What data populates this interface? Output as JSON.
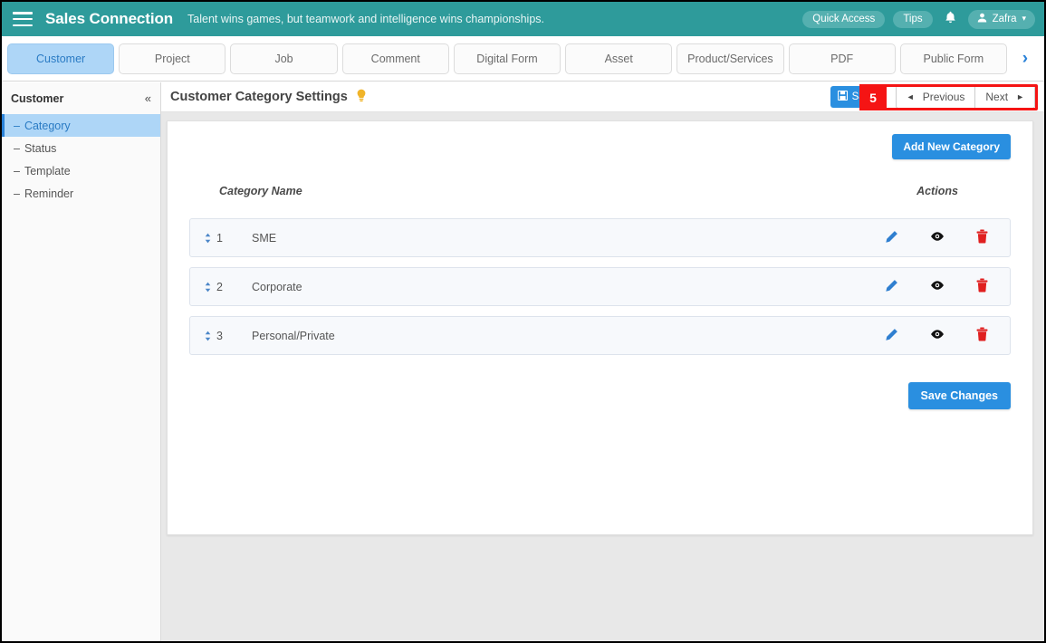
{
  "topbar": {
    "menu_icon": "hamburger-icon",
    "brand": "Sales Connection",
    "tagline": "Talent wins games, but teamwork and intelligence wins championships.",
    "quick_access": "Quick Access",
    "tips": "Tips",
    "bell_icon": "ὑ4",
    "user_name": "Zafra",
    "user_caret": "▾",
    "accent_color": "#2e9b9b"
  },
  "tabs": [
    {
      "label": "Customer",
      "active": true
    },
    {
      "label": "Project",
      "active": false
    },
    {
      "label": "Job",
      "active": false
    },
    {
      "label": "Comment",
      "active": false
    },
    {
      "label": "Digital Form",
      "active": false
    },
    {
      "label": "Asset",
      "active": false
    },
    {
      "label": "Product/Services",
      "active": false
    },
    {
      "label": "PDF",
      "active": false
    },
    {
      "label": "Public Form",
      "active": false
    }
  ],
  "tab_next_icon": "›",
  "sidebar": {
    "title": "Customer",
    "collapse_icon": "«",
    "items": [
      {
        "label": "Category",
        "active": true
      },
      {
        "label": "Status",
        "active": false
      },
      {
        "label": "Template",
        "active": false
      },
      {
        "label": "Reminder",
        "active": false
      }
    ]
  },
  "content_header": {
    "page_title": "Customer Category Settings",
    "hint_icon": "Ὂ1",
    "save_label": "Save",
    "save_icon": "ὋE",
    "previous_label": "Previous",
    "next_label": "Next",
    "prev_arrow": "◄",
    "next_arrow": "►"
  },
  "annotation": {
    "badge_number": "5",
    "color": "#f51414"
  },
  "card": {
    "add_new_label": "Add New Category",
    "columns": [
      "Category Name",
      "Actions"
    ],
    "rows": [
      {
        "order": "1",
        "name": "SME"
      },
      {
        "order": "2",
        "name": "Corporate"
      },
      {
        "order": "3",
        "name": "Personal/Private"
      }
    ],
    "action_icons": {
      "edit": "✎",
      "view": "◉",
      "delete": "Ὕ1"
    },
    "sort_up": "▴",
    "sort_down": "▾",
    "save_changes_label": "Save Changes"
  }
}
